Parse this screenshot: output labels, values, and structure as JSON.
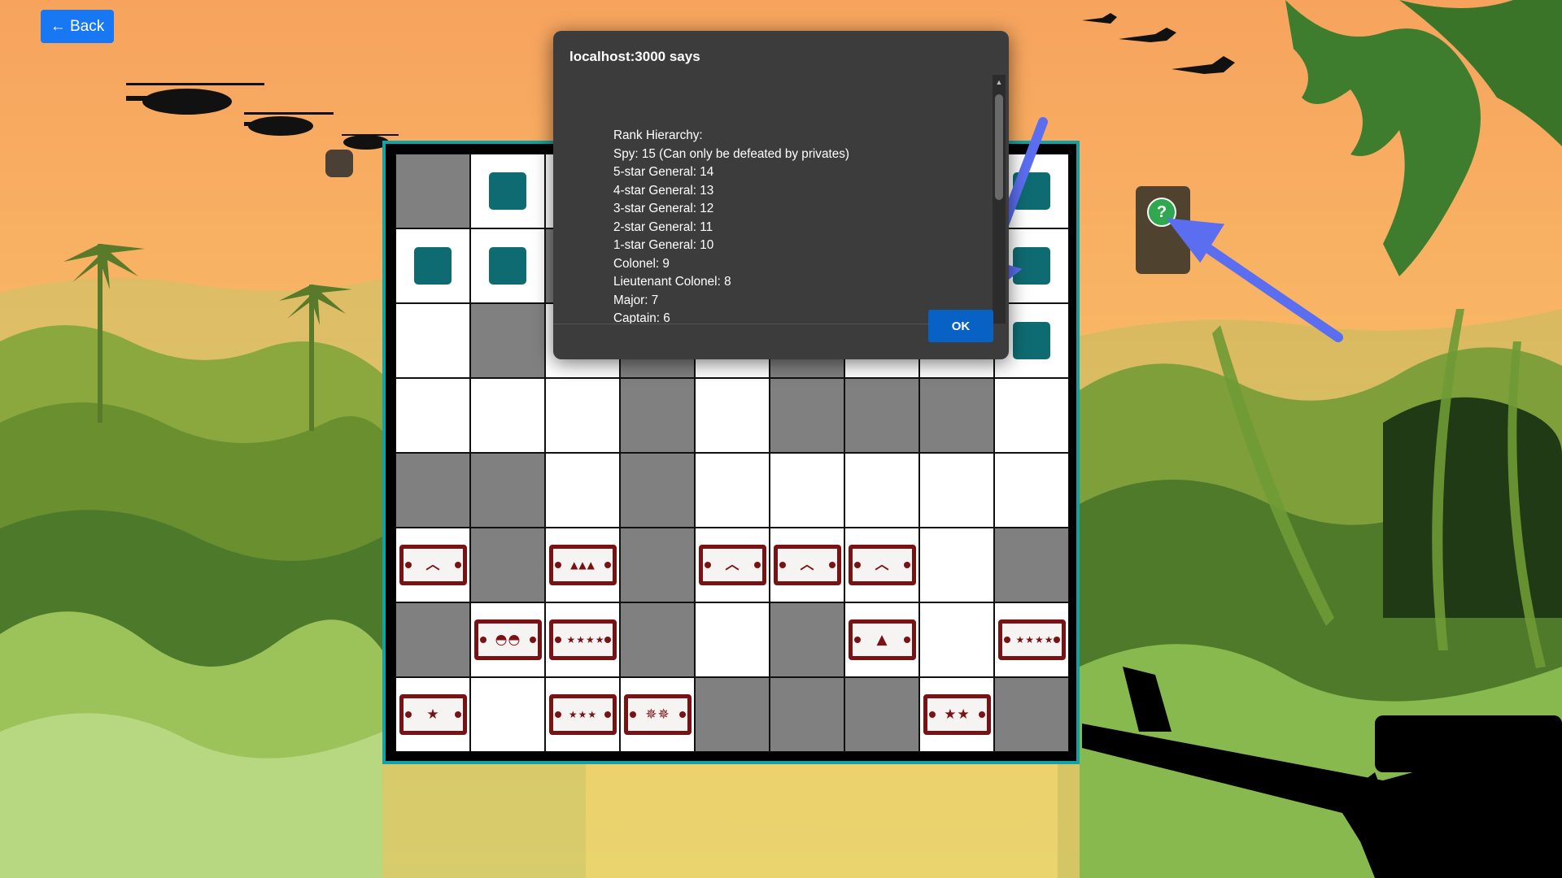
{
  "page": {
    "back_label": "← Back",
    "help_label": "?"
  },
  "dialog": {
    "title": "localhost:3000 says",
    "heading": "Rank Hierarchy:",
    "lines": [
      "Spy: 15 (Can only be defeated by privates)",
      "5-star General: 14",
      "4-star General: 13",
      "3-star General: 12",
      "2-star General: 11",
      "1-star General: 10",
      "Colonel: 9",
      "Lieutenant Colonel: 8",
      "Major: 7",
      "Captain: 6"
    ],
    "ok_label": "OK"
  },
  "board": {
    "columns": 9,
    "rows": 8,
    "cells": [
      [
        "d",
        "l",
        "l",
        "l",
        "l",
        "l",
        "l",
        "l",
        "l"
      ],
      [
        "l",
        "l",
        "d",
        "l",
        "l",
        "l",
        "l",
        "l",
        "l"
      ],
      [
        "l",
        "d",
        "l",
        "d",
        "l",
        "d",
        "l",
        "l",
        "l"
      ],
      [
        "l",
        "l",
        "l",
        "d",
        "l",
        "d",
        "d",
        "d",
        "l"
      ],
      [
        "d",
        "d",
        "l",
        "d",
        "l",
        "l",
        "l",
        "l",
        "l"
      ],
      [
        "l",
        "d",
        "l",
        "d",
        "l",
        "l",
        "l",
        "l",
        "d"
      ],
      [
        "d",
        "l",
        "l",
        "d",
        "l",
        "d",
        "l",
        "l",
        "l"
      ],
      [
        "l",
        "l",
        "l",
        "l",
        "d",
        "d",
        "d",
        "l",
        "d"
      ]
    ],
    "enemy_pieces": [
      {
        "row": 0,
        "col": 1
      },
      {
        "row": 0,
        "col": 8
      },
      {
        "row": 1,
        "col": 0
      },
      {
        "row": 1,
        "col": 1
      },
      {
        "row": 1,
        "col": 8
      },
      {
        "row": 2,
        "col": 8
      }
    ],
    "player_pieces": [
      {
        "row": 5,
        "col": 0,
        "symbol": "︿"
      },
      {
        "row": 5,
        "col": 2,
        "symbol": "▲▲▲"
      },
      {
        "row": 5,
        "col": 4,
        "symbol": "︿"
      },
      {
        "row": 5,
        "col": 5,
        "symbol": "︿"
      },
      {
        "row": 5,
        "col": 6,
        "symbol": "︿"
      },
      {
        "row": 6,
        "col": 1,
        "symbol": "◓◓"
      },
      {
        "row": 6,
        "col": 2,
        "symbol": "★★★★"
      },
      {
        "row": 6,
        "col": 6,
        "symbol": "▲"
      },
      {
        "row": 6,
        "col": 8,
        "symbol": "★★★★"
      },
      {
        "row": 7,
        "col": 0,
        "symbol": "★"
      },
      {
        "row": 7,
        "col": 2,
        "symbol": "★★★"
      },
      {
        "row": 7,
        "col": 3,
        "symbol": "✵✵"
      },
      {
        "row": 7,
        "col": 7,
        "symbol": "★★"
      }
    ]
  },
  "colors": {
    "board_frame": "#11a1a6",
    "enemy_piece": "#0f6b72",
    "player_piece": "#7a1214",
    "ok_button": "#0861c5",
    "back_button": "#1877f2",
    "annotation_arrow": "#5b6ef0",
    "help_button": "#2fa84f"
  },
  "icons": {
    "help": "question-icon",
    "back": "arrow-left-icon"
  }
}
